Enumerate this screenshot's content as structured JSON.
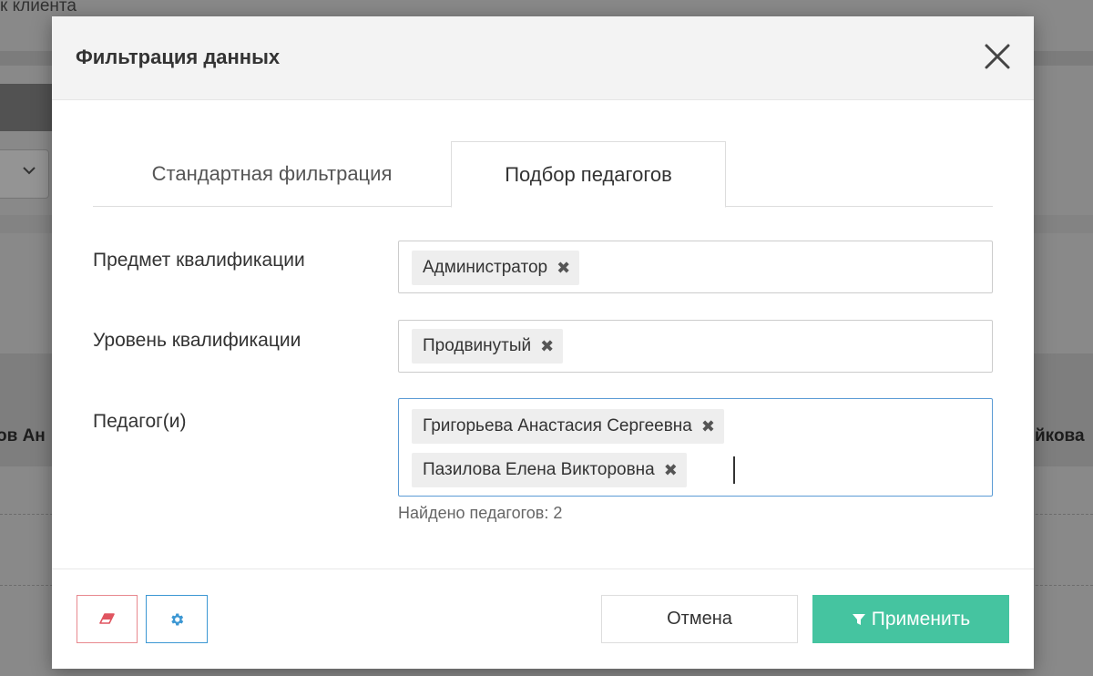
{
  "background": {
    "top_text": "к клиента",
    "cell_left": "ов Ан",
    "cell_right": "йкова"
  },
  "modal": {
    "title": "Фильтрация данных",
    "close_icon": "close-icon",
    "tabs": [
      {
        "label": "Стандартная фильтрация",
        "active": false
      },
      {
        "label": "Подбор педагогов",
        "active": true
      }
    ],
    "fields": {
      "subject": {
        "label": "Предмет квалификации",
        "tags": [
          "Администратор"
        ]
      },
      "level": {
        "label": "Уровень квалификации",
        "tags": [
          "Продвинутый"
        ]
      },
      "teachers": {
        "label": "Педагог(и)",
        "tags": [
          "Григорьева Анастасия Сергеевна",
          "Пазилова Елена Викторовна"
        ]
      }
    },
    "found_text": "Найдено педагогов: 2",
    "footer": {
      "clear_icon": "eraser-icon",
      "settings_icon": "gear-icon",
      "cancel_label": "Отмена",
      "apply_label": "Применить",
      "apply_icon": "filter-icon"
    }
  },
  "colors": {
    "accent_green": "#45c4a0",
    "clear_border": "#e8898f",
    "settings_border": "#3c97d3",
    "focus_border": "#5b9bd5"
  }
}
